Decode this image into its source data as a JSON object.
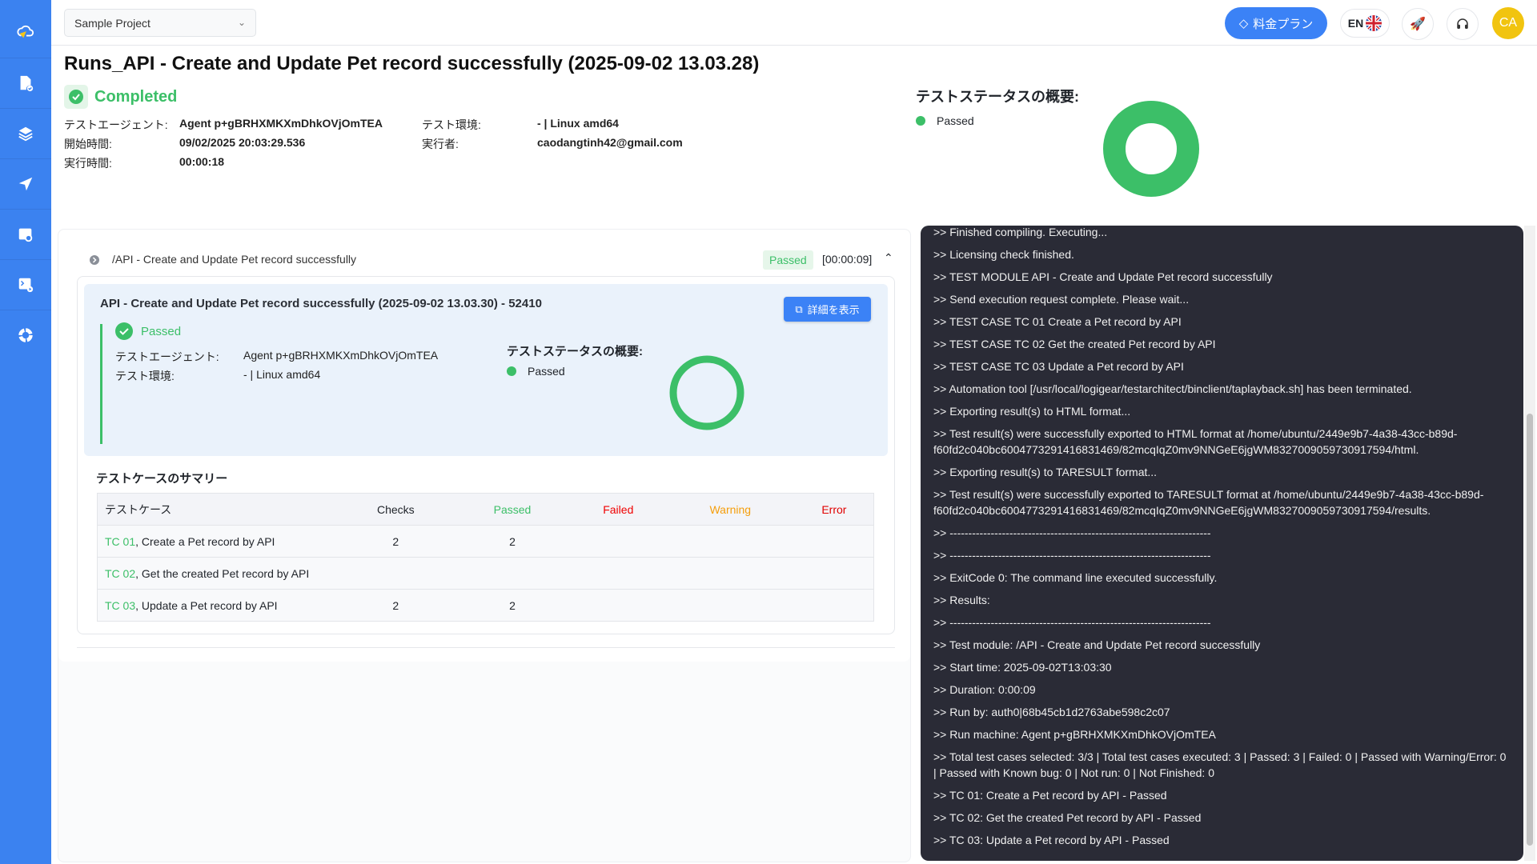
{
  "header": {
    "project": "Sample Project",
    "plan_label": "料金プラン",
    "lang": "EN",
    "avatar": "CA"
  },
  "sidebar": {
    "items": [
      "logo-icon",
      "test-doc-icon",
      "layers-icon",
      "send-icon",
      "browser-search-icon",
      "terminal-run-icon",
      "lifebuoy-icon"
    ]
  },
  "run": {
    "title": "Runs_API - Create and Update Pet record successfully (2025-09-02 13.03.28)",
    "status": "Completed",
    "labels": {
      "agent": "テストエージェント:",
      "start": "開始時間:",
      "duration": "実行時間:",
      "env": "テスト環境:",
      "runner": "実行者:"
    },
    "values": {
      "agent": "Agent p+gBRHXMKXmDhkOVjOmTEA",
      "start": "09/02/2025 20:03:29.536",
      "duration": "00:00:18",
      "env": "- | Linux amd64",
      "runner": "caodangtinh42@gmail.com"
    },
    "summary_title": "テストステータスの概要:",
    "legend_passed": "Passed"
  },
  "module": {
    "path": "/API - Create and Update Pet record successfully",
    "status": "Passed",
    "time": "[00:00:09]",
    "detail_title": "API - Create and Update Pet record successfully (2025-09-02 13.03.30) - 52410",
    "detail_button": "詳細を表示",
    "result": "Passed",
    "agent_label": "テストエージェント:",
    "agent": "Agent p+gBRHXMKXmDhkOVjOmTEA",
    "env_label": "テスト環境:",
    "env": "- | Linux amd64",
    "summary_title": "テストステータスの概要:",
    "legend_passed": "Passed"
  },
  "testcases": {
    "heading": "テストケースのサマリー",
    "columns": [
      "テストケース",
      "Checks",
      "Passed",
      "Failed",
      "Warning",
      "Error"
    ],
    "rows": [
      {
        "id": "TC 01",
        "name": ", Create a Pet record by API",
        "checks": "2",
        "passed": "2",
        "failed": "",
        "warning": "",
        "error": ""
      },
      {
        "id": "TC 02",
        "name": ", Get the created Pet record by API",
        "checks": "",
        "passed": "",
        "failed": "",
        "warning": "",
        "error": ""
      },
      {
        "id": "TC 03",
        "name": ", Update a Pet record by API",
        "checks": "2",
        "passed": "2",
        "failed": "",
        "warning": "",
        "error": ""
      }
    ]
  },
  "colors": {
    "accent": "#3b82f6",
    "passed": "#3cbf68",
    "failed": "#f00000",
    "warning": "#f59e0b",
    "error": "#e00000",
    "console_bg": "#2a2b36"
  },
  "console": {
    "lines": [
      ">> Finished compiling. Executing...",
      ">> Licensing check finished.",
      ">> TEST MODULE API - Create and Update Pet record successfully",
      ">> Send execution request complete. Please wait...",
      ">> TEST CASE TC 01 Create a Pet record by API",
      ">> TEST CASE TC 02 Get the created Pet record by API",
      ">> TEST CASE TC 03 Update a Pet record by API",
      ">> Automation tool [/usr/local/logigear/testarchitect/binclient/taplayback.sh] has been terminated.",
      ">> Exporting result(s) to HTML format...",
      ">> Test result(s) were successfully exported to HTML format at /home/ubuntu/2449e9b7-4a38-43cc-b89d-f60fd2c040bc6004773291416831469/82mcqIqZ0mv9NNGeE6jgWM8327009059730917594/html.",
      ">> Exporting result(s) to TARESULT format...",
      ">> Test result(s) were successfully exported to TARESULT format at /home/ubuntu/2449e9b7-4a38-43cc-b89d-f60fd2c040bc6004773291416831469/82mcqIqZ0mv9NNGeE6jgWM8327009059730917594/results.",
      ">> ----------------------------------------------------------------------",
      ">> ----------------------------------------------------------------------",
      ">> ExitCode 0: The command line executed successfully.",
      ">> Results:",
      ">> ----------------------------------------------------------------------",
      ">> Test module: /API - Create and Update Pet record successfully",
      ">> Start time: 2025-09-02T13:03:30",
      ">> Duration: 0:00:09",
      ">> Run by: auth0|68b45cb1d2763abe598c2c07",
      ">> Run machine: Agent p+gBRHXMKXmDhkOVjOmTEA",
      ">> Total test cases selected: 3/3 | Total test cases executed: 3 | Passed: 3 | Failed: 0 | Passed with Warning/Error: 0 | Passed with Known bug: 0 | Not run: 0 | Not Finished: 0",
      ">> TC 01: Create a Pet record by API - Passed",
      ">> TC 02: Get the created Pet record by API - Passed",
      ">> TC 03: Update a Pet record by API - Passed"
    ]
  }
}
